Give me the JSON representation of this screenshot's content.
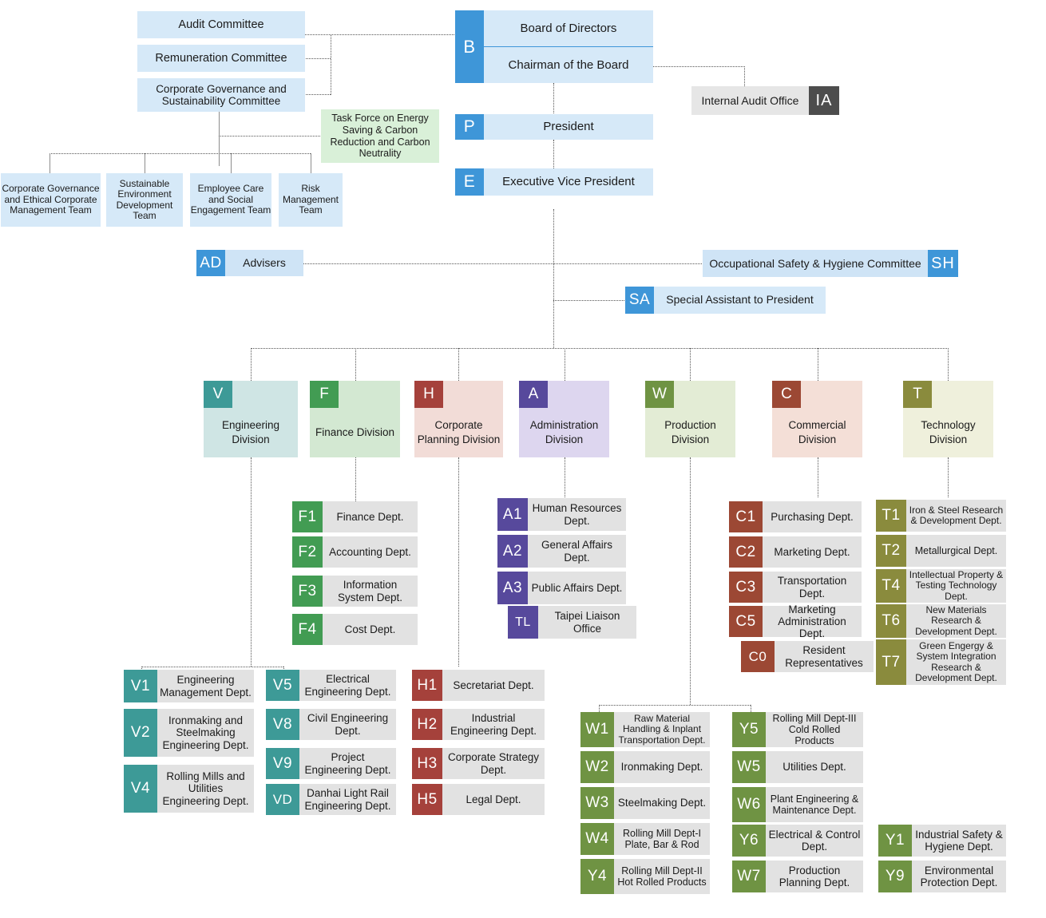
{
  "committees": [
    {
      "name": "audit-committee",
      "label": "Audit Committee"
    },
    {
      "name": "remuneration-committee",
      "label": "Remuneration Committee"
    },
    {
      "name": "corporate-governance-committee",
      "label": "Corporate Governance and Sustainability Committee"
    }
  ],
  "task_force": {
    "label": "Task Force on Energy Saving & Carbon Reduction and Carbon Neutrality",
    "color": "#d9f0d8"
  },
  "teams": [
    {
      "name": "corporate-governance-ethical-team",
      "label": "Corporate Governance and Ethical Corporate Management Team"
    },
    {
      "name": "sustainable-environment-team",
      "label": "Sustainable Environment Development Team"
    },
    {
      "name": "employee-care-team",
      "label": "Employee Care and Social Engagement Team"
    },
    {
      "name": "risk-management-team",
      "label": "Risk Management Team"
    }
  ],
  "board": {
    "code": "B",
    "line1": "Board of Directors",
    "line2": "Chairman of the Board",
    "code_color": "#3e96d8",
    "body_color": "#d6e9f8"
  },
  "executives": [
    {
      "name": "president",
      "code": "P",
      "label": "President"
    },
    {
      "name": "executive-vice-president",
      "code": "E",
      "label": "Executive Vice President"
    }
  ],
  "internal_audit": {
    "label": "Internal Audit Office",
    "code": "IA",
    "code_color": "#4d4d4d",
    "body_color": "#e6e6e6"
  },
  "advisers": {
    "label": "Advisers",
    "code": "AD",
    "code_color": "#3e96d8",
    "body_color": "#cfe4f6"
  },
  "occupational_safety": {
    "label": "Occupational Safety & Hygiene Committee",
    "code": "SH",
    "code_color": "#3e96d8",
    "body_color": "#cfe4f6"
  },
  "special_assistant": {
    "label": "Special Assistant to President",
    "code": "SA",
    "code_color": "#3e96d8",
    "body_color": "#d6e9f8"
  },
  "divisions": [
    {
      "name": "engineering-division",
      "code": "V",
      "label": "Engineering Division",
      "chip_color": "#3d9a97",
      "body_color": "#cfe5e4"
    },
    {
      "name": "finance-division",
      "code": "F",
      "label": "Finance Division",
      "chip_color": "#429c53",
      "body_color": "#d3e8d2"
    },
    {
      "name": "corporate-planning-division",
      "code": "H",
      "label": "Corporate Planning Division",
      "chip_color": "#a5413b",
      "body_color": "#f2dcd7"
    },
    {
      "name": "administration-division",
      "code": "A",
      "label": "Administration Division",
      "chip_color": "#57499c",
      "body_color": "#ddd6ef"
    },
    {
      "name": "production-division",
      "code": "W",
      "label": "Production Division",
      "chip_color": "#6f9343",
      "body_color": "#e3ecd5"
    },
    {
      "name": "commercial-division",
      "code": "C",
      "label": "Commercial Division",
      "chip_color": "#9c4834",
      "body_color": "#f4dfd7"
    },
    {
      "name": "technology-division",
      "code": "T",
      "label": "Technology Division",
      "chip_color": "#8a8b3d",
      "body_color": "#eff0dc"
    }
  ],
  "dept_body_color": "#e2e2e2",
  "finance_depts": [
    {
      "code": "F1",
      "label": "Finance Dept."
    },
    {
      "code": "F2",
      "label": "Accounting Dept."
    },
    {
      "code": "F3",
      "label": "Information System Dept."
    },
    {
      "code": "F4",
      "label": "Cost Dept."
    }
  ],
  "administration_depts": [
    {
      "code": "A1",
      "label": "Human Resources Dept."
    },
    {
      "code": "A2",
      "label": "General Affairs Dept."
    },
    {
      "code": "A3",
      "label": "Public Affairs Dept."
    },
    {
      "code": "TL",
      "label": "Taipei Liaison Office"
    }
  ],
  "commercial_depts": [
    {
      "code": "C1",
      "label": "Purchasing Dept."
    },
    {
      "code": "C2",
      "label": "Marketing Dept."
    },
    {
      "code": "C3",
      "label": "Transportation Dept."
    },
    {
      "code": "C5",
      "label": "Marketing Administration Dept."
    },
    {
      "code": "C0",
      "label": "Resident Representatives"
    }
  ],
  "technology_depts": [
    {
      "code": "T1",
      "label": "Iron & Steel Research & Development Dept."
    },
    {
      "code": "T2",
      "label": "Metallurgical Dept."
    },
    {
      "code": "T4",
      "label": "Intellectual Property & Testing Technology Dept."
    },
    {
      "code": "T6",
      "label": "New Materials Research & Development Dept."
    },
    {
      "code": "T7",
      "label": "Green Engergy & System Integration Research & Development Dept."
    }
  ],
  "engineering_depts_a": [
    {
      "code": "V1",
      "label": "Engineering Management Dept."
    },
    {
      "code": "V2",
      "label": "Ironmaking and Steelmaking Engineering Dept."
    },
    {
      "code": "V4",
      "label": "Rolling Mills and Utilities Engineering Dept."
    }
  ],
  "engineering_depts_b": [
    {
      "code": "V5",
      "label": "Electrical Engineering Dept."
    },
    {
      "code": "V8",
      "label": "Civil Engineering Dept."
    },
    {
      "code": "V9",
      "label": "Project Engineering Dept."
    },
    {
      "code": "VD",
      "label": "Danhai Light Rail Engineering Dept."
    }
  ],
  "planning_depts": [
    {
      "code": "H1",
      "label": "Secretariat Dept."
    },
    {
      "code": "H2",
      "label": "Industrial Engineering Dept."
    },
    {
      "code": "H3",
      "label": "Corporate Strategy Dept."
    },
    {
      "code": "H5",
      "label": "Legal Dept."
    }
  ],
  "production_depts_a": [
    {
      "code": "W1",
      "label": "Raw Material Handling & Inplant Transportation Dept."
    },
    {
      "code": "W2",
      "label": "Ironmaking Dept."
    },
    {
      "code": "W3",
      "label": "Steelmaking Dept."
    },
    {
      "code": "W4",
      "label": "Rolling Mill Dept-I Plate, Bar & Rod"
    },
    {
      "code": "Y4",
      "label": "Rolling Mill Dept-II Hot Rolled Products"
    }
  ],
  "production_depts_b": [
    {
      "code": "Y5",
      "label": "Rolling Mill Dept-III Cold Rolled Products"
    },
    {
      "code": "W5",
      "label": "Utilities Dept."
    },
    {
      "code": "W6",
      "label": "Plant Engineering & Maintenance Dept."
    },
    {
      "code": "Y6",
      "label": "Electrical & Control Dept."
    },
    {
      "code": "W7",
      "label": "Production Planning Dept."
    }
  ],
  "production_depts_c": [
    {
      "code": "Y1",
      "label": "Industrial Safety & Hygiene Dept."
    },
    {
      "code": "Y9",
      "label": "Environmental Protection Dept."
    }
  ]
}
